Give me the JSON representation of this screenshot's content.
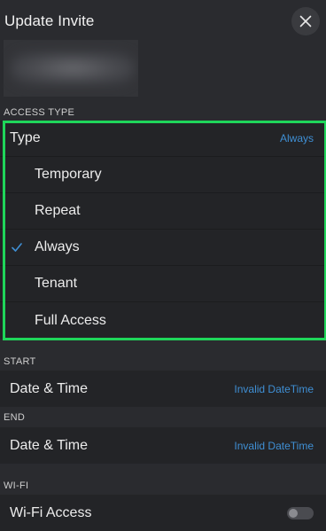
{
  "header": {
    "title": "Update Invite",
    "close_icon": "close-icon"
  },
  "sections": {
    "access_type": {
      "label": "ACCESS TYPE",
      "type_row": {
        "label": "Type",
        "value": "Always"
      },
      "options": [
        {
          "label": "Temporary",
          "selected": false
        },
        {
          "label": "Repeat",
          "selected": false
        },
        {
          "label": "Always",
          "selected": true
        },
        {
          "label": "Tenant",
          "selected": false
        },
        {
          "label": "Full Access",
          "selected": false
        }
      ]
    },
    "start": {
      "label": "START",
      "row": {
        "label": "Date & Time",
        "value": "Invalid DateTime"
      }
    },
    "end": {
      "label": "END",
      "row": {
        "label": "Date & Time",
        "value": "Invalid DateTime"
      }
    },
    "wifi": {
      "label": "WI-FI",
      "row": {
        "label": "Wi-Fi Access",
        "enabled": false
      }
    }
  },
  "colors": {
    "background": "#2a2b2f",
    "row_background": "#232427",
    "accent": "#3f8fd4",
    "highlight": "#1fd65a"
  }
}
